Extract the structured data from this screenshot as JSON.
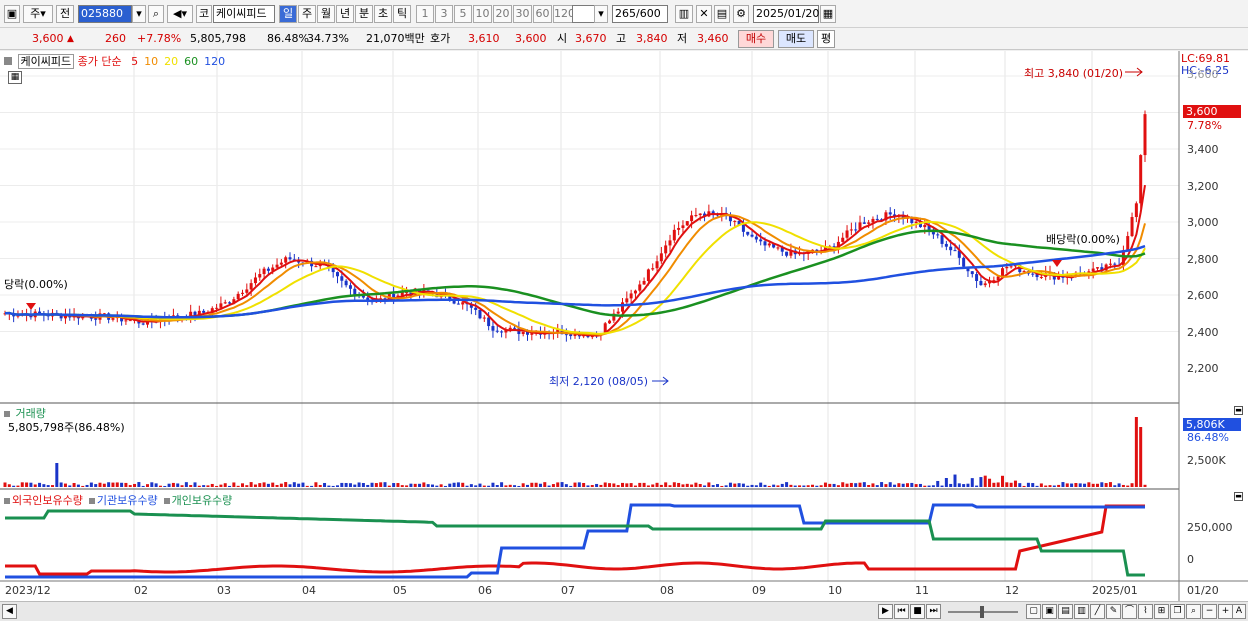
{
  "toolbar": {
    "market_label": "주",
    "prev_label": "전",
    "code": "025880",
    "sort_label": "코",
    "name": "케이씨피드",
    "period_tabs": [
      "일",
      "주",
      "월",
      "년",
      "분",
      "초",
      "틱"
    ],
    "active_period": "일",
    "intervals": [
      "1",
      "3",
      "5",
      "10",
      "20",
      "30",
      "60",
      "120"
    ],
    "count": "265",
    "count_total": "/600",
    "date": "2025/01/20"
  },
  "quote": {
    "price": "3,600",
    "change": "260",
    "change_pct": "+7.78%",
    "volume": "5,805,798",
    "vol_ratio": "86.48%",
    "turnover": "34.73%",
    "amount": "21,070백만",
    "ask_label": "호가",
    "ask1": "3,610",
    "ask2": "3,600",
    "open_label": "시",
    "open": "3,670",
    "high_label": "고",
    "high": "3,840",
    "low_label": "저",
    "low": "3,460",
    "buy_label": "매수",
    "sell_label": "매도",
    "flat_label": "평"
  },
  "price_pane": {
    "stock_label": "케이씨피드",
    "ma_label": "종가 단순",
    "ma_periods": [
      "5",
      "10",
      "20",
      "60",
      "120"
    ],
    "ma_colors": [
      "#e01010",
      "#f08c00",
      "#f0e000",
      "#1a9020",
      "#2050e0"
    ],
    "lc": "LC:69.81",
    "hc": "HC:-6.25",
    "cur_price": "3,600",
    "cur_pct": "7.78%",
    "high_note": "최고 3,840 (01/20)",
    "low_note": "최저 2,120 (08/05)",
    "div1": "당락(0.00%)",
    "div2": "배당락(0.00%)",
    "yticks": [
      "3,400",
      "3,200",
      "3,000",
      "2,800",
      "2,600",
      "2,400",
      "2,200"
    ],
    "ytop": "3,600"
  },
  "volume_pane": {
    "title": "거래량",
    "value": "5,805,798주(86.48%)",
    "axis_value": "5,806K",
    "axis_pct": "86.48%",
    "tick": "2,500K"
  },
  "holdings_pane": {
    "series": [
      "외국인보유수량",
      "기관보유수량",
      "개인보유수량"
    ],
    "colors": [
      "#e01010",
      "#2050e0",
      "#1a9050"
    ],
    "ticks": [
      "250,000",
      "0"
    ]
  },
  "xaxis": {
    "labels": [
      "2023/12",
      "02",
      "03",
      "04",
      "05",
      "06",
      "07",
      "08",
      "09",
      "10",
      "11",
      "12",
      "2025/01"
    ],
    "right_label": "01/20"
  }
}
